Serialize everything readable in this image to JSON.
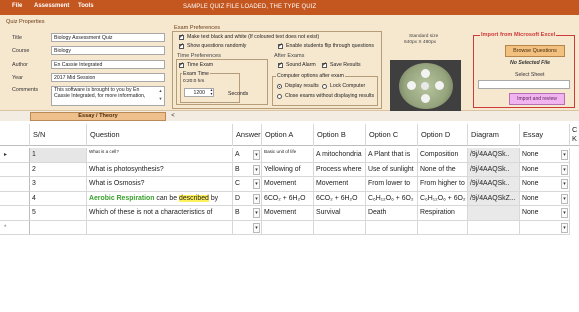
{
  "titlebar": {
    "menu": [
      "File",
      "Assessment",
      "Tools"
    ],
    "title": "SAMPLE QUIZ FILE LOADED, THE TYPE QUIZ"
  },
  "quiz_properties": {
    "header": "Quiz Properties",
    "fields": [
      {
        "label": "Title",
        "value": "Biology Assessment Quiz"
      },
      {
        "label": "Course",
        "value": "Biology"
      },
      {
        "label": "Author",
        "value": "En Cassie Integrated"
      },
      {
        "label": "Year",
        "value": "2017 Mid Session"
      }
    ],
    "comments_label": "Comments",
    "comments_value": "This software is brought to you by En Cassie Integrated, for more information,"
  },
  "exam_preferences": {
    "header": "Exam Preferences",
    "checks": [
      "Make text black and white (If coloured text does not exist)",
      "Show questions randomly",
      "Enable students flip through questions"
    ],
    "time_prefs": {
      "header": "Time Preferences",
      "time_exam": "Time Exam",
      "exam_time_label": "Exam Time",
      "exam_time_display": "0:20:0 hrs",
      "seconds_value": "1200",
      "seconds_label": "Seconds"
    },
    "after_exams": {
      "header": "After Exams",
      "sound_alarm": "Sound Alarm",
      "save_results": "Save Results",
      "computer_options_header": "Computer options after exam",
      "radio_display": "Display results",
      "radio_lock": "Lock Computer",
      "radio_close": "Close exams without displaying results"
    }
  },
  "image_preview": {
    "label_line1": "Standard size",
    "label_line2": "640px X 480px"
  },
  "excel_import": {
    "header": "Import from Microsoft Excel",
    "browse_label": "Browse Questions",
    "no_file_label": "No Selected File",
    "select_sheet_label": "Select Sheet",
    "import_review_label": "Import and review"
  },
  "tabs": {
    "essay_theory": "Essay / Theory",
    "arrow": "<"
  },
  "grid": {
    "columns": [
      "S/N",
      "Question",
      "Answer",
      "Option A",
      "Option B",
      "Option C",
      "Option D",
      "Diagram",
      "Essay",
      "C",
      "K"
    ],
    "rows": [
      {
        "sn": "1",
        "question": "What is a cell?",
        "answer": "A",
        "a": "Basic unit of life",
        "b": "A mitochondria",
        "c": "A Plant that is",
        "d": "Composition",
        "diagram": "/9j/4AAQSk..",
        "essay": "None"
      },
      {
        "sn": "2",
        "question": "What is photosynthesis?",
        "answer": "B",
        "a": "Yellowing of",
        "b": "Process where",
        "c": "Use of sunlight",
        "d": "None of the",
        "diagram": "/9j/4AAQSk..",
        "essay": "None"
      },
      {
        "sn": "3",
        "question": "What is Osmosis?",
        "answer": "C",
        "a": "Movement",
        "b": "Movement",
        "c": "From lower to",
        "d": "From higher to",
        "diagram": "/9j/4AAQSk..",
        "essay": "None"
      },
      {
        "sn": "4",
        "question_parts": [
          "Aerobic Respiration",
          " can be ",
          "described",
          " by"
        ],
        "answer": "D",
        "a": "6CO₂ + 6H₂O",
        "b": "6CO₂ + 6H₂O",
        "c": "C₆H₁₂O₆ + 6O₂",
        "d": "C₆H₁₂O₆ + 6O₂",
        "diagram": "/9j/4AAQSkZ...",
        "essay": "None"
      },
      {
        "sn": "5",
        "question": "Which of these is not a characteristics of",
        "answer": "B",
        "a": "Movement",
        "b": "Survival",
        "c": "Death",
        "d": "Respiration",
        "diagram": "",
        "essay": "None"
      }
    ],
    "new_row_marker": "*",
    "current_row_marker": "▸",
    "dropdown_glyph": "▾"
  }
}
